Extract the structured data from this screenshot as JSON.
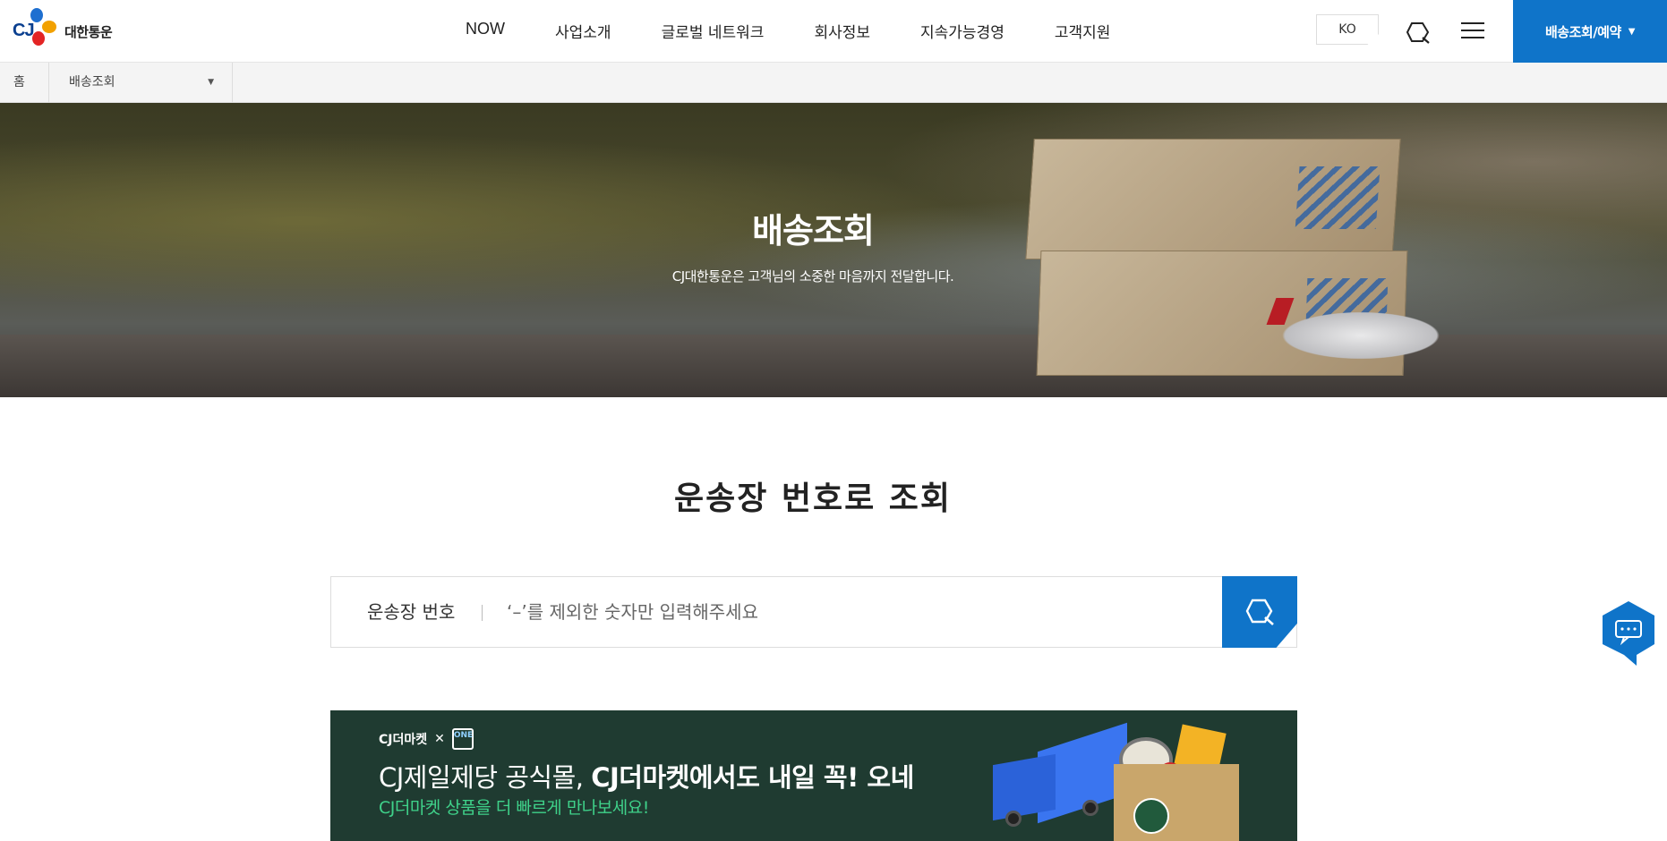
{
  "header": {
    "logo_mark": "CJ",
    "logo_name": "대한통운",
    "nav": [
      "NOW",
      "사업소개",
      "글로벌 네트워크",
      "회사정보",
      "지속가능경영",
      "고객지원"
    ],
    "lang": "KO",
    "cta_label": "배송조회/예약",
    "icons": {
      "search": "search-icon",
      "menu": "hamburger-menu-icon",
      "cta_caret": "caret-down-icon"
    }
  },
  "breadcrumb": {
    "home": "홈",
    "current": "배송조회"
  },
  "hero": {
    "title": "배송조회",
    "subtitle": "CJ대한통운은 고객님의 소중한 마음까지 전달합니다."
  },
  "tracking": {
    "title": "운송장 번호로 조회",
    "label": "운송장 번호",
    "value": "",
    "placeholder": "‘–’를 제외한 숫자만 입력해주세요"
  },
  "banner": {
    "brand_text": "CJ더마켓",
    "brand_x": "✕",
    "brand_one": "ONE",
    "headline_prefix": "CJ제일제당 공식몰, ",
    "headline_bold": "CJ더마켓에서도 내일 꼭! 오네",
    "description": "CJ더마켓 상품을 더 빠르게 만나보세요!",
    "colors": {
      "background": "#1f3b31",
      "accent": "#3fd28a"
    }
  },
  "floating": {
    "chat_icon": "chat-bubble-icon"
  },
  "colors": {
    "brand_blue": "#0f74c9"
  }
}
